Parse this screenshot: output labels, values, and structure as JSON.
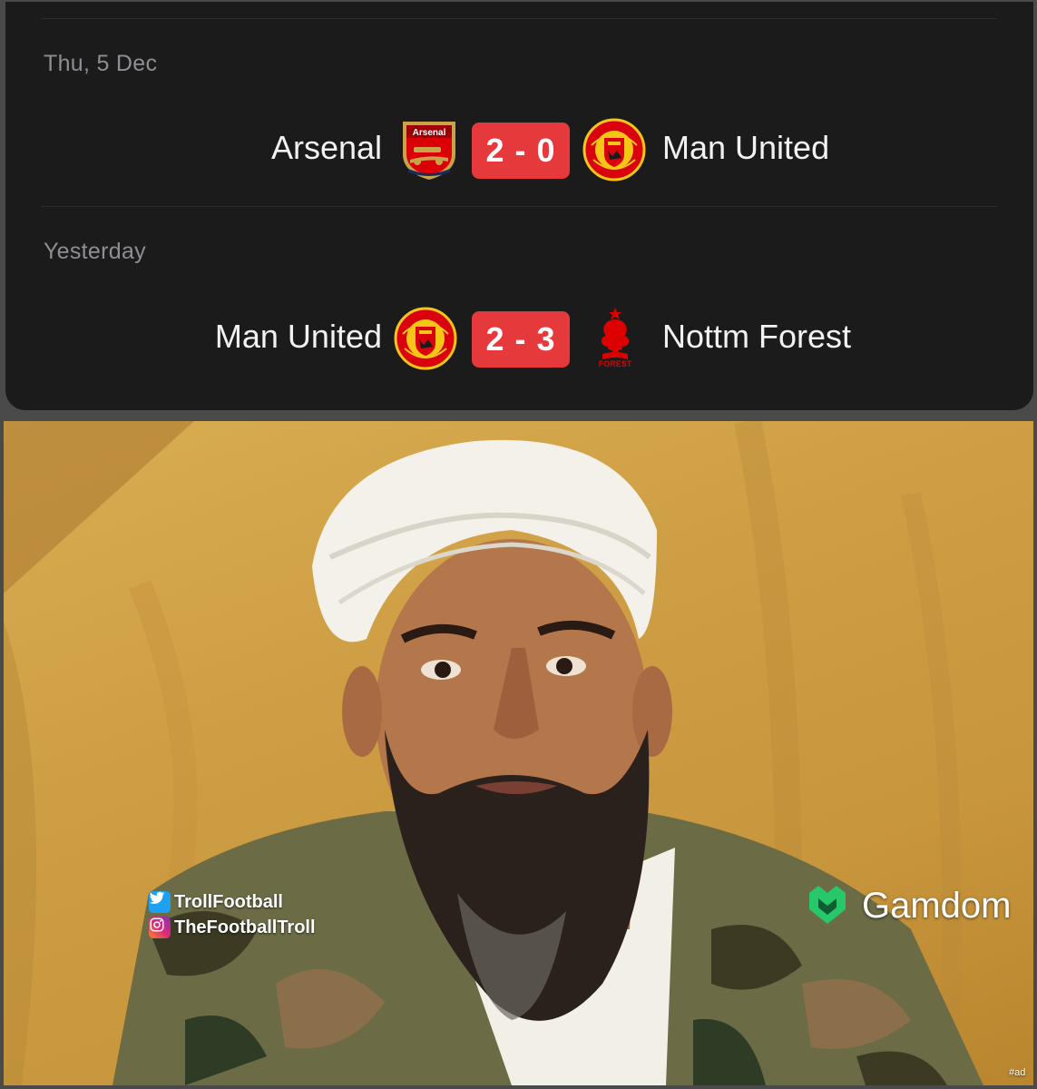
{
  "fixtures": [
    {
      "date": "Thu, 5 Dec",
      "home": "Arsenal",
      "home_crest": "arsenal-crest",
      "score": "2 - 0",
      "away": "Man United",
      "away_crest": "man-united-crest"
    },
    {
      "date": "Yesterday",
      "home": "Man United",
      "home_crest": "man-united-crest",
      "score": "2 - 3",
      "away": "Nottm Forest",
      "away_crest": "nottm-forest-crest"
    }
  ],
  "crest_text": {
    "arsenal": "Arsenal",
    "forest": "FOREST"
  },
  "watermark": {
    "twitter": "TrollFootball",
    "instagram": "TheFootballTroll"
  },
  "sponsor": {
    "name": "Gamdom",
    "tag": "#ad"
  },
  "colors": {
    "panel_bg": "#1b1b1c",
    "score_bg": "#e5393b",
    "text": "#f2f2f2",
    "muted": "#8e8e93",
    "gamdom_green": "#27c86a"
  }
}
